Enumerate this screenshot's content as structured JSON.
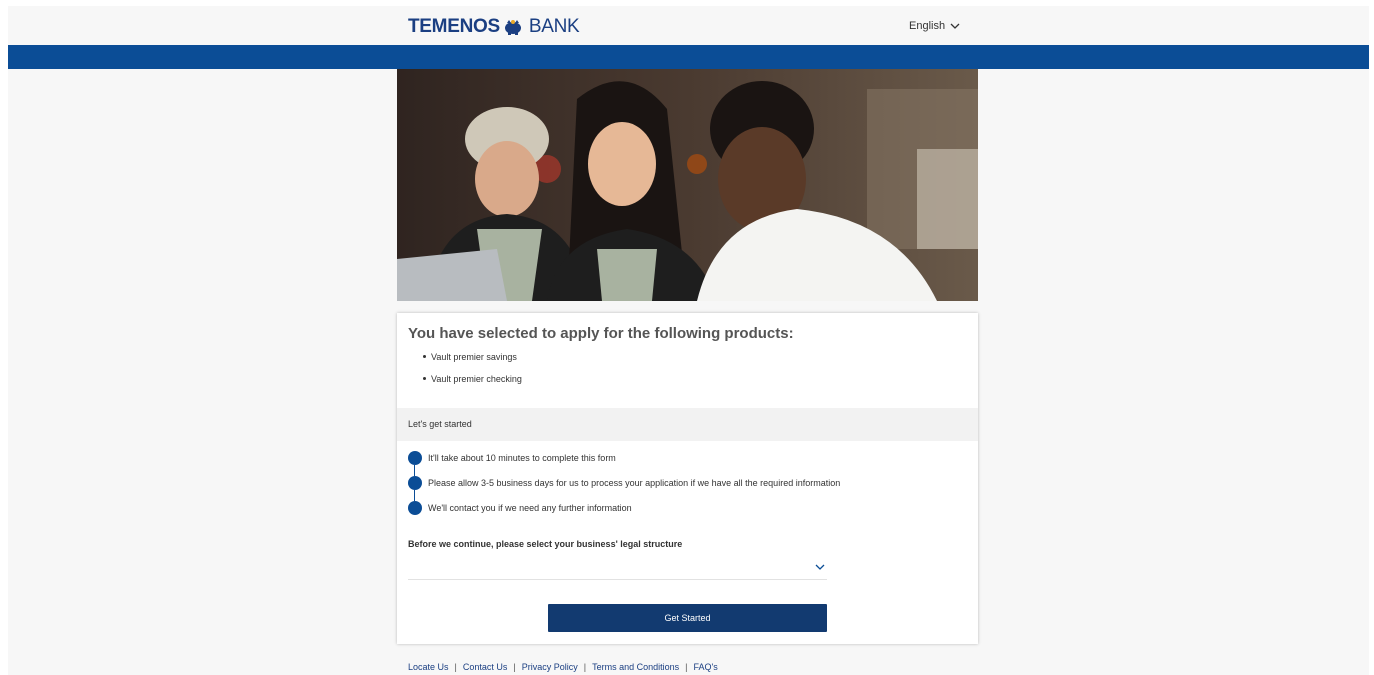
{
  "header": {
    "logo_left": "TEMENOS",
    "logo_right": "BANK",
    "language": "English"
  },
  "hero": {
    "image": "three-women-at-laptop-photo"
  },
  "card": {
    "title": "You have selected to apply for the following products:",
    "products": [
      "Vault premier savings",
      "Vault premier checking"
    ],
    "section_label": "Let's get started",
    "steps": [
      "It'll take about 10 minutes to complete this form",
      "Please allow 3-5 business days for us to process your application if we have all the required information",
      "We'll contact you if we need any further information"
    ],
    "legal_label": "Before we continue, please select your business' legal structure",
    "legal_value": "",
    "button_label": "Get Started"
  },
  "footer": {
    "links": [
      "Locate Us",
      "Contact Us",
      "Privacy Policy",
      "Terms and Conditions",
      "FAQ's"
    ]
  },
  "colors": {
    "brand_blue": "#0b4d96",
    "button_navy": "#123a70",
    "logo_blue": "#1b3f82",
    "logo_icon_gold": "#e8a92b"
  }
}
